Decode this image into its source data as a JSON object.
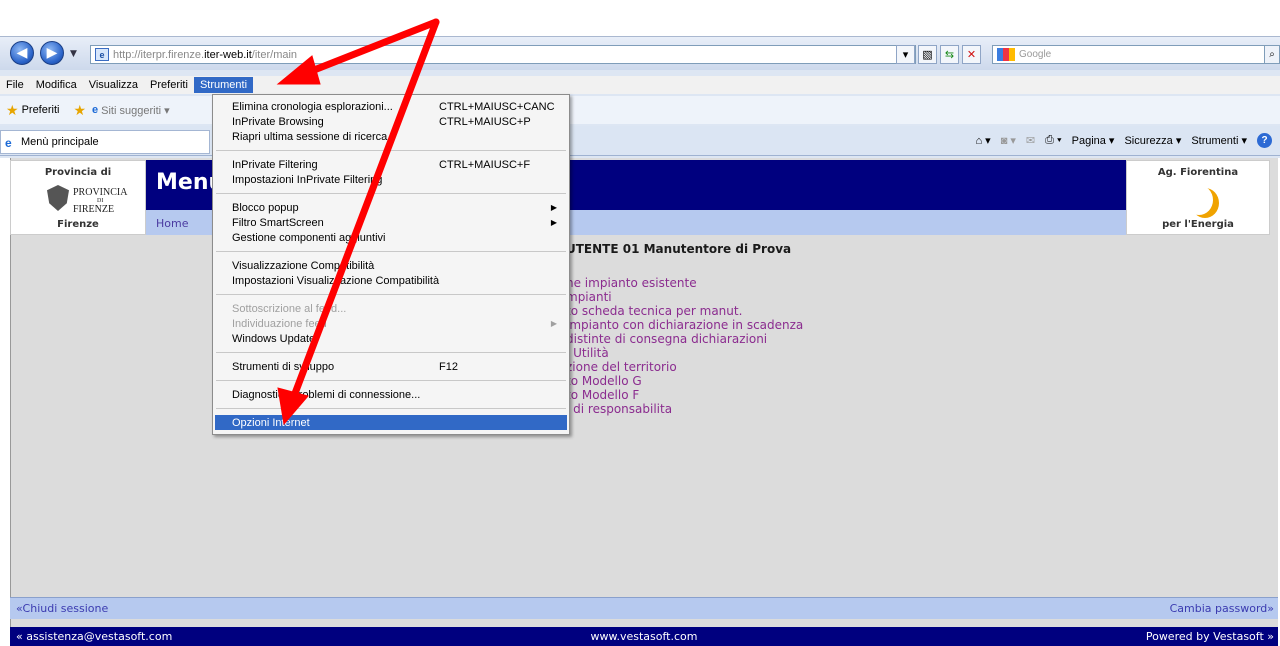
{
  "browser": {
    "url_prefix": "http://iterpr.firenze.",
    "url_domain": "iter-web.it",
    "url_suffix": "/iter/main",
    "search_placeholder": "Google",
    "back_label": "◀",
    "forward_label": "▶",
    "menus": [
      "File",
      "Modifica",
      "Visualizza",
      "Preferiti",
      "Strumenti"
    ],
    "favorites_label": "Preferiti",
    "suggested_label": "Siti suggeriti ▾",
    "tab_title": "Menù principale",
    "command_items": [
      "Pagina ▾",
      "Sicurezza ▾",
      "Strumenti ▾"
    ]
  },
  "tools_menu": {
    "items": [
      {
        "label": "Elimina cronologia esplorazioni...",
        "shortcut": "CTRL+MAIUSC+CANC"
      },
      {
        "label": "InPrivate Browsing",
        "shortcut": "CTRL+MAIUSC+P"
      },
      {
        "label": "Riapri ultima sessione di ricerca",
        "shortcut": ""
      },
      {
        "label": "InPrivate Filtering",
        "shortcut": "CTRL+MAIUSC+F"
      },
      {
        "label": "Impostazioni InPrivate Filtering",
        "shortcut": ""
      },
      {
        "label": "Blocco popup",
        "shortcut": ""
      },
      {
        "label": "Filtro SmartScreen",
        "shortcut": ""
      },
      {
        "label": "Gestione componenti aggiuntivi",
        "shortcut": ""
      },
      {
        "label": "Visualizzazione Compatibilità",
        "shortcut": ""
      },
      {
        "label": "Impostazioni Visualizzazione Compatibilità",
        "shortcut": ""
      },
      {
        "label": "Sottoscrizione al feed...",
        "shortcut": ""
      },
      {
        "label": "Individuazione feed",
        "shortcut": ""
      },
      {
        "label": "Windows Update",
        "shortcut": ""
      },
      {
        "label": "Strumenti di sviluppo",
        "shortcut": "F12"
      },
      {
        "label": "Diagnostica problemi di connessione...",
        "shortcut": ""
      },
      {
        "label": "Opzioni Internet",
        "shortcut": ""
      }
    ]
  },
  "site": {
    "left_logo_top": "Provincia di",
    "left_logo_name_1": "PROVINCIA",
    "left_logo_name_2": "DI",
    "left_logo_name_3": "FIRENZE",
    "left_logo_bottom": "Firenze",
    "page_heading": "Menù",
    "home_link": "Home",
    "right_logo_top": "Ag. Fiorentina",
    "right_logo_bottom": "per l'Energia",
    "user_line": "UTENTE 01 Manutentore di Prova",
    "links": [
      "ne impianto esistente",
      "mpianti",
      "to scheda tecnica per manut.",
      "impianto con dichiarazione in scadenza",
      "distinte di consegna dichiarazioni",
      "i Utilità",
      "zione del territorio",
      "to Modello G",
      "to Modello F",
      "i di responsabilita"
    ],
    "footer_left": "«Chiudi sessione",
    "footer_right": "Cambia password»",
    "bottom_left": "« assistenza@vestasoft.com",
    "bottom_center": "www.vestasoft.com",
    "bottom_right": "Powered by Vestasoft »"
  },
  "colors": {
    "site_blue": "#00007f",
    "site_light_blue": "#b6c9ef",
    "menu_highlight": "#3169c6",
    "annotation_arrow": "#ff0000",
    "link_purple": "#8b2c8f"
  }
}
